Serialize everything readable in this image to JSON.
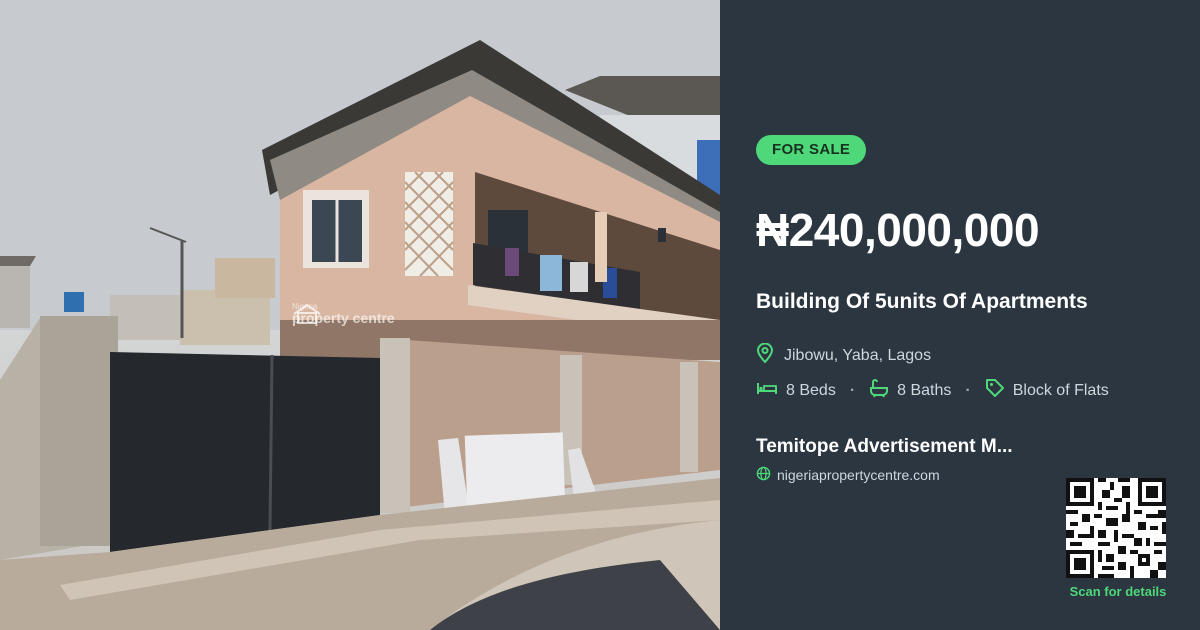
{
  "listing": {
    "status_badge": "FOR SALE",
    "price": "₦240,000,000",
    "title": "Building Of 5units Of Apartments",
    "location": "Jibowu, Yaba, Lagos",
    "beds": "8 Beds",
    "baths": "8 Baths",
    "property_type": "Block of Flats",
    "separator": "·"
  },
  "agent": {
    "name": "Temitope Advertisement M...",
    "website": "nigeriapropertycentre.com"
  },
  "qr": {
    "caption": "Scan for details"
  },
  "photo": {
    "watermark_small": "Nigeria",
    "watermark_big": "property centre"
  },
  "colors": {
    "panel_bg": "#2b3640",
    "accent_green": "#4ed87a",
    "text_muted": "#cfd6dc"
  },
  "icons": {
    "location": "map-pin-icon",
    "beds": "bed-icon",
    "baths": "bathtub-icon",
    "type": "tag-icon",
    "website": "globe-icon"
  }
}
